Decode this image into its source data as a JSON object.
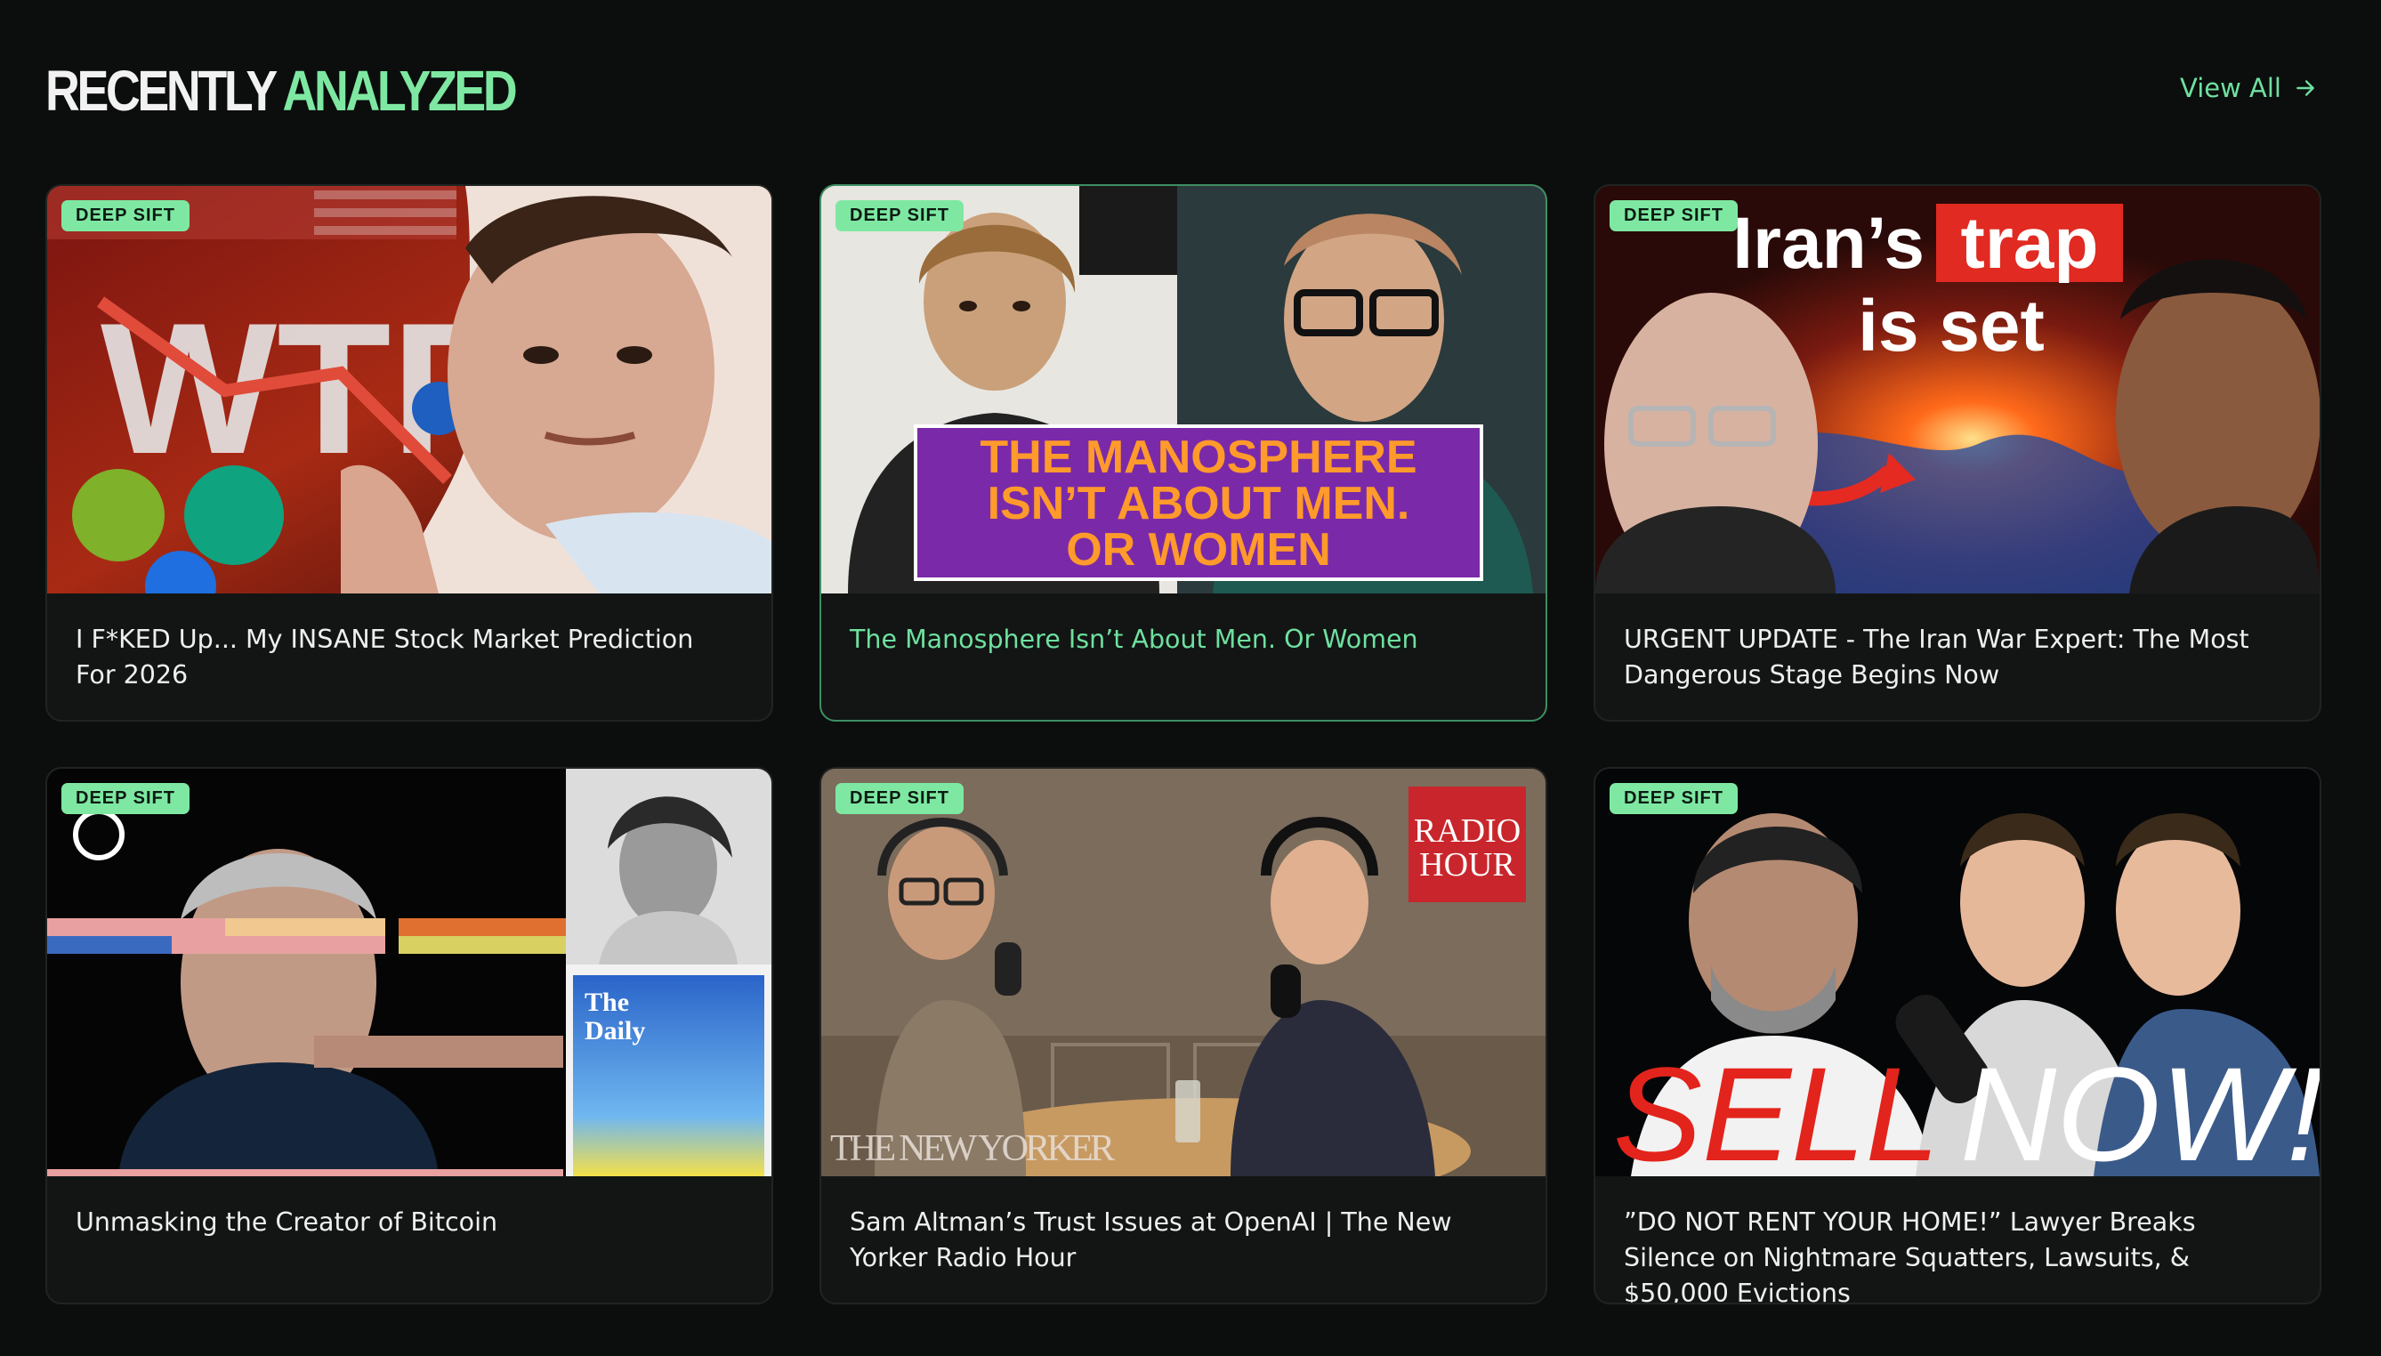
{
  "section": {
    "title_word1": "RECENTLY",
    "title_word2": "ANALYZED",
    "view_all_label": "View All"
  },
  "colors": {
    "accent": "#7ee8a2",
    "background": "#0b0e0d",
    "card": "#121514"
  },
  "cards": [
    {
      "badge": "DEEP SIFT",
      "title": "I F*KED Up... My INSANE Stock Market Prediction For 2026",
      "thumb_text": "WTF"
    },
    {
      "badge": "DEEP SIFT",
      "title": "The Manosphere Isn’t About Men. Or Women",
      "thumb_lines": [
        "THE MANOSPHERE",
        "ISN’T ABOUT MEN.",
        "OR WOMEN"
      ],
      "selected": true
    },
    {
      "badge": "DEEP SIFT",
      "title": "URGENT UPDATE - The Iran War Expert: The Most Dangerous Stage Begins Now",
      "thumb_text_a": "Iran’s",
      "thumb_text_b": "trap",
      "thumb_text_c": "is set"
    },
    {
      "badge": "DEEP SIFT",
      "title": "Unmasking the Creator of Bitcoin",
      "thumb_text_a": "The",
      "thumb_text_b": "Daily"
    },
    {
      "badge": "DEEP SIFT",
      "title": "Sam Altman’s Trust Issues at OpenAI | The New Yorker Radio Hour",
      "thumb_text_a": "RADIO",
      "thumb_text_b": "HOUR",
      "thumb_text_c": "THE NEW YORKER"
    },
    {
      "badge": "DEEP SIFT",
      "title": "”DO NOT RENT YOUR HOME!” Lawyer Breaks Silence on Nightmare Squatters, Lawsuits, & $50,000 Evictions",
      "thumb_text_a": "SELL",
      "thumb_text_b": "NOW!"
    }
  ]
}
